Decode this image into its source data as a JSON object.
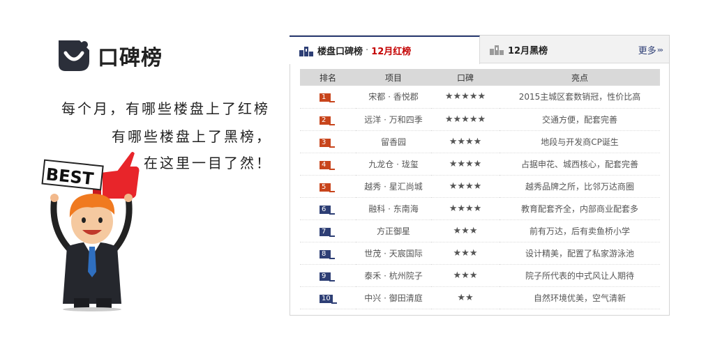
{
  "brand": {
    "title": "口碑榜"
  },
  "slogan": {
    "line1": "每个月，有哪些楼盘上了红榜",
    "line2": "有哪些楼盘上了黑榜，",
    "line3": "在这里一目了然！"
  },
  "mascot": {
    "sign_text": "BEST"
  },
  "tabs": {
    "red": {
      "prefix": "楼盘口碑榜",
      "separator": "·",
      "label": "12月红榜"
    },
    "black": {
      "label": "12月黑榜"
    },
    "more": {
      "label": "更多",
      "arrow": "›››"
    }
  },
  "table": {
    "headers": {
      "rank": "排名",
      "project": "项目",
      "reputation": "口碑",
      "highlight": "亮点"
    },
    "rows": [
      {
        "rank": "1",
        "project": "宋都 · 香悦郡",
        "stars": "★★★★★",
        "highlight": "2015主城区套数销冠，性价比高"
      },
      {
        "rank": "2",
        "project": "远洋 · 万和四季",
        "stars": "★★★★★",
        "highlight": "交通方便，配套完善"
      },
      {
        "rank": "3",
        "project": "留香园",
        "stars": "★★★★",
        "highlight": "地段与开发商CP诞生"
      },
      {
        "rank": "4",
        "project": "九龙仓 · 珑玺",
        "stars": "★★★★",
        "highlight": "占据申花、城西核心，配套完善"
      },
      {
        "rank": "5",
        "project": "越秀 · 星汇尚城",
        "stars": "★★★★",
        "highlight": "越秀品牌之所，比邻万达商圈"
      },
      {
        "rank": "6",
        "project": "融科 · 东南海",
        "stars": "★★★★",
        "highlight": "教育配套齐全，内部商业配套多"
      },
      {
        "rank": "7",
        "project": "方正御星",
        "stars": "★★★",
        "highlight": "前有万达，后有卖鱼桥小学"
      },
      {
        "rank": "8",
        "project": "世茂 · 天宸国际",
        "stars": "★★★",
        "highlight": "设计精美，配置了私家游泳池"
      },
      {
        "rank": "9",
        "project": "泰禾 · 杭州院子",
        "stars": "★★★",
        "highlight": "院子所代表的中式风让人期待"
      },
      {
        "rank": "10",
        "project": "中兴 · 御田清庭",
        "stars": "★★",
        "highlight": "自然环境优美，空气清新"
      }
    ]
  },
  "colors": {
    "rank_top": "#c8451c",
    "rank_rest": "#2e3f75",
    "tab_accent": "#2e3f75",
    "red_label": "#c40000",
    "header_bg": "#d9d9d9"
  }
}
